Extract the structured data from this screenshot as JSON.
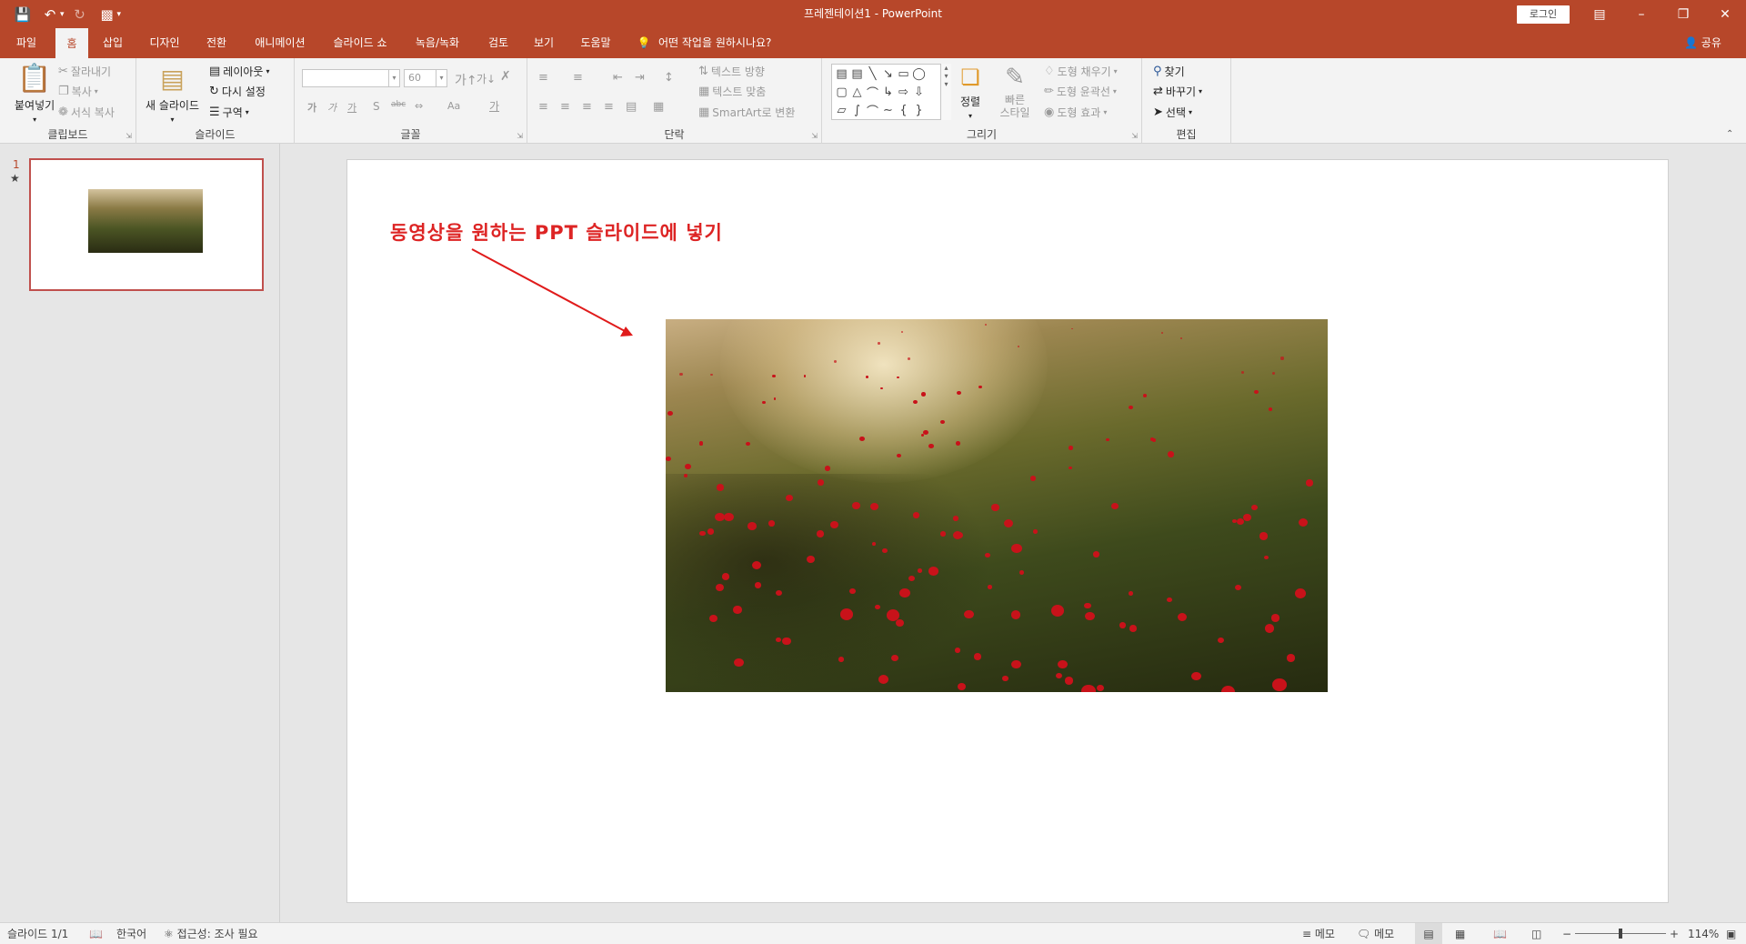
{
  "window": {
    "title": "프레젠테이션1 - PowerPoint",
    "login_label": "로그인",
    "share_label": "공유"
  },
  "tabs": [
    {
      "label": "파일"
    },
    {
      "label": "홈",
      "active": true
    },
    {
      "label": "삽입"
    },
    {
      "label": "디자인"
    },
    {
      "label": "전환"
    },
    {
      "label": "애니메이션"
    },
    {
      "label": "슬라이드 쇼"
    },
    {
      "label": "녹음/녹화"
    },
    {
      "label": "검토"
    },
    {
      "label": "보기"
    },
    {
      "label": "도움말"
    },
    {
      "label": "어떤 작업을 원하시나요?"
    }
  ],
  "ribbon": {
    "clipboard": {
      "label": "클립보드",
      "paste": "붙여넣기",
      "cut": "잘라내기",
      "copy": "복사",
      "format_painter": "서식 복사"
    },
    "slides": {
      "label": "슬라이드",
      "new_slide": "새 슬라이드",
      "layout": "레이아웃",
      "reset": "다시 설정",
      "section": "구역"
    },
    "font": {
      "label": "글꼴",
      "size_value": "60"
    },
    "paragraph": {
      "label": "단락",
      "text_direction": "텍스트 방향",
      "align_text": "텍스트 맞춤",
      "smartart": "SmartArt로 변환"
    },
    "drawing": {
      "label": "그리기",
      "arrange": "정렬",
      "quick_styles": "빠른 스타일",
      "shape_fill": "도형 채우기",
      "shape_outline": "도형 윤곽선",
      "shape_effects": "도형 효과"
    },
    "editing": {
      "label": "편집",
      "find": "찾기",
      "replace": "바꾸기",
      "select": "선택"
    }
  },
  "slide_panel": {
    "slide_number": "1",
    "star": "★"
  },
  "slide": {
    "caption": "동영상을 원하는 PPT 슬라이드에 넣기"
  },
  "status": {
    "slide_count": "슬라이드 1/1",
    "language": "한국어",
    "accessibility": "접근성: 조사 필요",
    "notes": "메모",
    "comments": "메모",
    "zoom": "114%"
  },
  "colors": {
    "accent": "#b7472a",
    "caption": "#dd2424",
    "arrow": "#e01b1b"
  }
}
